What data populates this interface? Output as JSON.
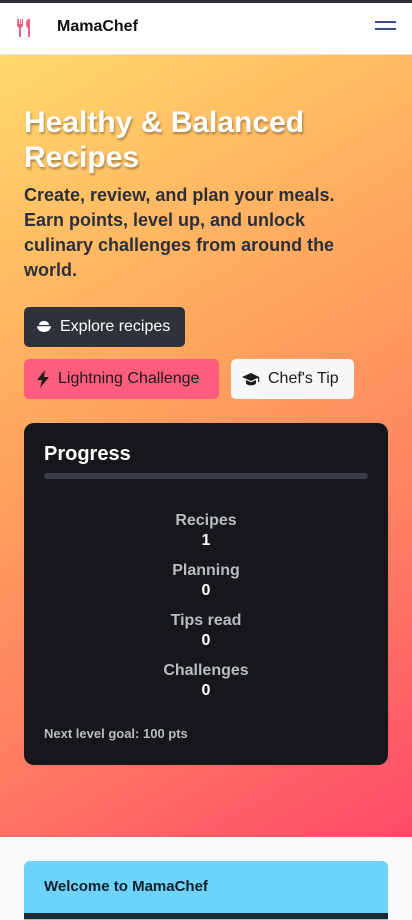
{
  "app": {
    "name": "MamaChef"
  },
  "hero": {
    "title": "Healthy & Balanced Recipes",
    "subtitle": "Create, review, and plan your meals. Earn points, level up, and unlock culinary challenges from around the world.",
    "buttons": {
      "explore": "Explore recipes",
      "lightning": "Lightning Challenge",
      "tip": "Chef's Tip"
    }
  },
  "progress": {
    "title": "Progress",
    "level_fraction": 0,
    "stats": [
      {
        "label": "Recipes",
        "value": "1"
      },
      {
        "label": "Planning",
        "value": "0"
      },
      {
        "label": "Tips read",
        "value": "0"
      },
      {
        "label": "Challenges",
        "value": "0"
      }
    ],
    "next_goal": "Next level goal: 100 pts"
  },
  "welcome": {
    "title": "Welcome to MamaChef"
  },
  "colors": {
    "accent": "#ff5d7d",
    "dark": "#2d323b",
    "info": "#6dd3fb"
  },
  "icons": {
    "brand": "utensils-icon",
    "menu": "hamburger-menu-icon",
    "explore": "bowl-icon",
    "lightning": "bolt-icon",
    "tip": "graduation-cap-icon"
  }
}
